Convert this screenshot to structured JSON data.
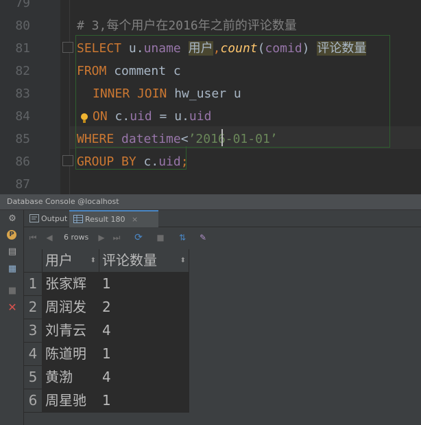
{
  "editor": {
    "line_numbers": [
      "79",
      "80",
      "81",
      "82",
      "83",
      "84",
      "85",
      "86",
      "87"
    ],
    "comment": "# 3,每个用户在2016年之前的评论数量",
    "l81": {
      "select": "SELECT",
      "u": "u.",
      "uname": "uname",
      "alias1": "用户",
      "comma": ",",
      "count": "count",
      "paren_open": "(",
      "comid": "comid",
      "paren_close": ")",
      "alias2": "评论数量"
    },
    "l82": {
      "from": "FROM",
      "rest": " comment c"
    },
    "l83": {
      "inner": "INNER JOIN",
      "rest": " hw_user u"
    },
    "l84": {
      "on": "ON",
      "c": " c.",
      "uid1": "uid",
      "eq": " = u.",
      "uid2": "uid"
    },
    "l85": {
      "where": "WHERE",
      "datetime": "datetime",
      "lt": "<",
      "str": "’2016-01-01’"
    },
    "l86": {
      "group": "GROUP BY",
      "c": " c.",
      "uid": "uid",
      "semi": ";"
    }
  },
  "console": {
    "title": "Database Console @localhost",
    "tabs": {
      "output": "Output",
      "result": "Result 180",
      "close": "×"
    },
    "rows_label": "6 rows"
  },
  "grid": {
    "headers": [
      "用户",
      "评论数量"
    ],
    "rows": [
      {
        "idx": "1",
        "user": "张家辉",
        "count": "1"
      },
      {
        "idx": "2",
        "user": "周润发",
        "count": "2"
      },
      {
        "idx": "3",
        "user": "刘青云",
        "count": "4"
      },
      {
        "idx": "4",
        "user": "陈道明",
        "count": "1"
      },
      {
        "idx": "5",
        "user": "黄渤",
        "count": "4"
      },
      {
        "idx": "6",
        "user": "周星驰",
        "count": "1"
      }
    ]
  },
  "colors": {
    "keyword": "#cc7832",
    "field": "#9876aa",
    "string": "#6a8759",
    "comment": "#808080",
    "function": "#ffc66d",
    "accent": "#4a88c7"
  },
  "icons": [
    "wrench-icon",
    "p-icon",
    "pin-icon",
    "layout-icon",
    "stop-icon",
    "close-icon",
    "output-icon",
    "table-icon",
    "first-icon",
    "prev-icon",
    "next-icon",
    "last-icon",
    "refresh-icon",
    "stop-query-icon",
    "sort-icon",
    "pin-tab-icon"
  ]
}
